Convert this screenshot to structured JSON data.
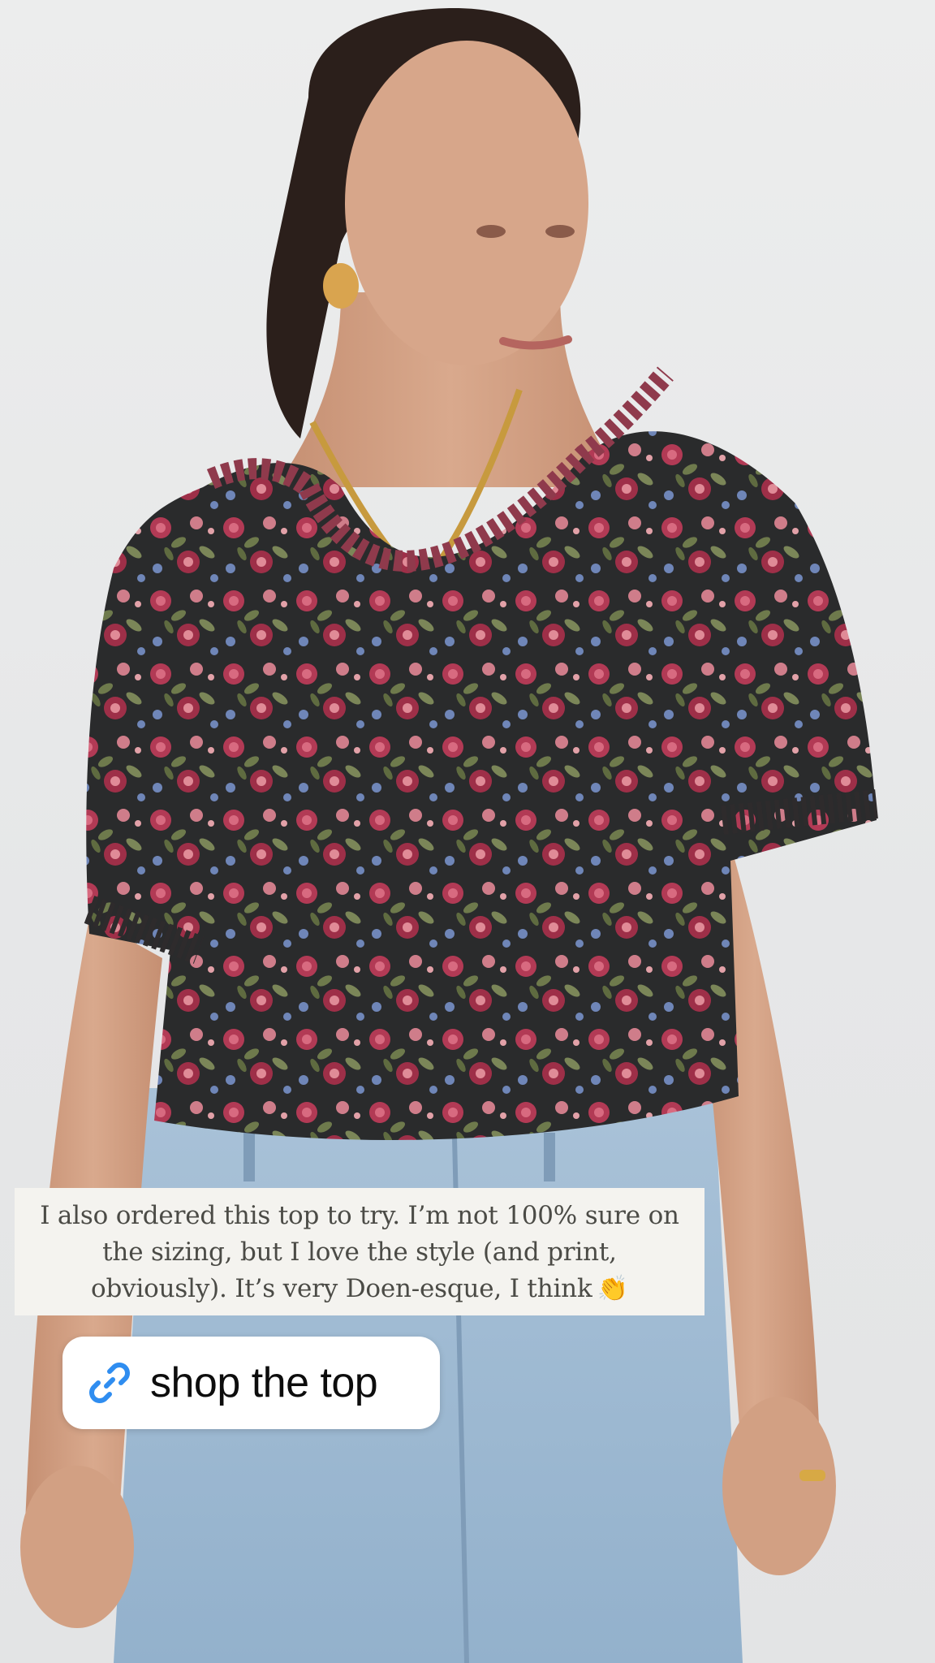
{
  "story": {
    "caption": "I also ordered this top to try. I’m not 100% sure on\nthe sizing, but I love the style (and print,\nobviously). It’s very Doen-esque, I think",
    "caption_emoji": "👏",
    "link_sticker": {
      "label": "shop the top",
      "icon": "link-icon"
    }
  },
  "colors": {
    "link_accent": "#2f8df0",
    "caption_bg": "#f4f3ef",
    "caption_text": "#4b4b46"
  }
}
